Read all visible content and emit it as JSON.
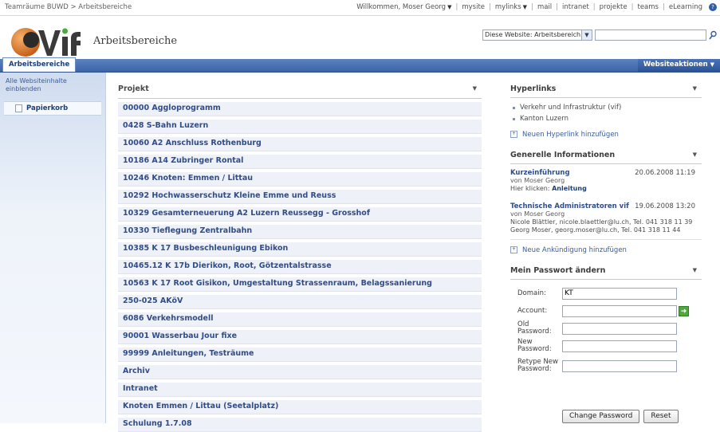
{
  "topbar": {
    "breadcrumb": "Teamräume BUWD > Arbeitsbereiche",
    "welcome": "Willkommen, Moser Georg",
    "links": [
      "mysite",
      "mylinks",
      "mail",
      "intranet",
      "projekte",
      "teams",
      "eLearning"
    ]
  },
  "header": {
    "site_title": "Arbeitsbereiche",
    "search_scope": "Diese Website: Arbeitsbereich",
    "search_value": ""
  },
  "nav": {
    "active_tab": "Arbeitsbereiche",
    "site_actions": "Websiteaktionen"
  },
  "leftnav": {
    "view_all": "Alle Websiteinhalte einblenden",
    "recycle_bin": "Papierkorb"
  },
  "projects": {
    "header": "Projekt",
    "items": [
      "00000 Aggloprogramm",
      "0428 S-Bahn Luzern",
      "10060 A2 Anschluss Rothenburg",
      "10186 A14 Zubringer Rontal",
      "10246 Knoten: Emmen / Littau",
      "10292 Hochwasserschutz Kleine Emme und Reuss",
      "10329 Gesamterneuerung A2 Luzern Reussegg - Grosshof",
      "10330 Tieflegung Zentralbahn",
      "10385 K 17 Busbeschleunigung Ebikon",
      "10465.12 K 17b Dierikon, Root, Götzentalstrasse",
      "10563 K 17 Root Gisikon, Umgestaltung Strassenraum, Belagssanierung",
      "250-025 AKöV",
      "6086 Verkehrsmodell",
      "90001 Wasserbau Jour fixe",
      "99999 Anleitungen, Testräume",
      "Archiv",
      "Intranet",
      "Knoten Emmen / Littau (Seetalplatz)",
      "Schulung 1.7.08"
    ]
  },
  "hyperlinks": {
    "title": "Hyperlinks",
    "items": [
      "Verkehr und Infrastruktur (vif)",
      "Kanton Luzern"
    ],
    "add": "Neuen Hyperlink hinzufügen"
  },
  "general": {
    "title": "Generelle Informationen",
    "a1_title": "Kurzeinführung",
    "a1_date": "20.06.2008 11:19",
    "a1_author": "von Moser Georg",
    "a1_body_prefix": "Hier klicken:",
    "a1_body_link": "Anleitung",
    "a2_title": "Technische Administratoren vif",
    "a2_date": "19.06.2008 13:20",
    "a2_author": "von Moser Georg",
    "a2_line1": "Nicole Blättler, nicole.blaettler@lu.ch, Tel. 041 318 11 39",
    "a2_line2": "Georg Moser, georg.moser@lu.ch, Tel. 041 318 11 44",
    "add": "Neue Ankündigung hinzufügen"
  },
  "password": {
    "title": "Mein Passwort ändern",
    "domain_label": "Domain:",
    "domain_value": "KT",
    "account_label": "Account:",
    "old_label": "Old Password:",
    "new_label": "New Password:",
    "retype_label": "Retype New Password:",
    "change_button": "Change Password",
    "reset_button": "Reset"
  }
}
